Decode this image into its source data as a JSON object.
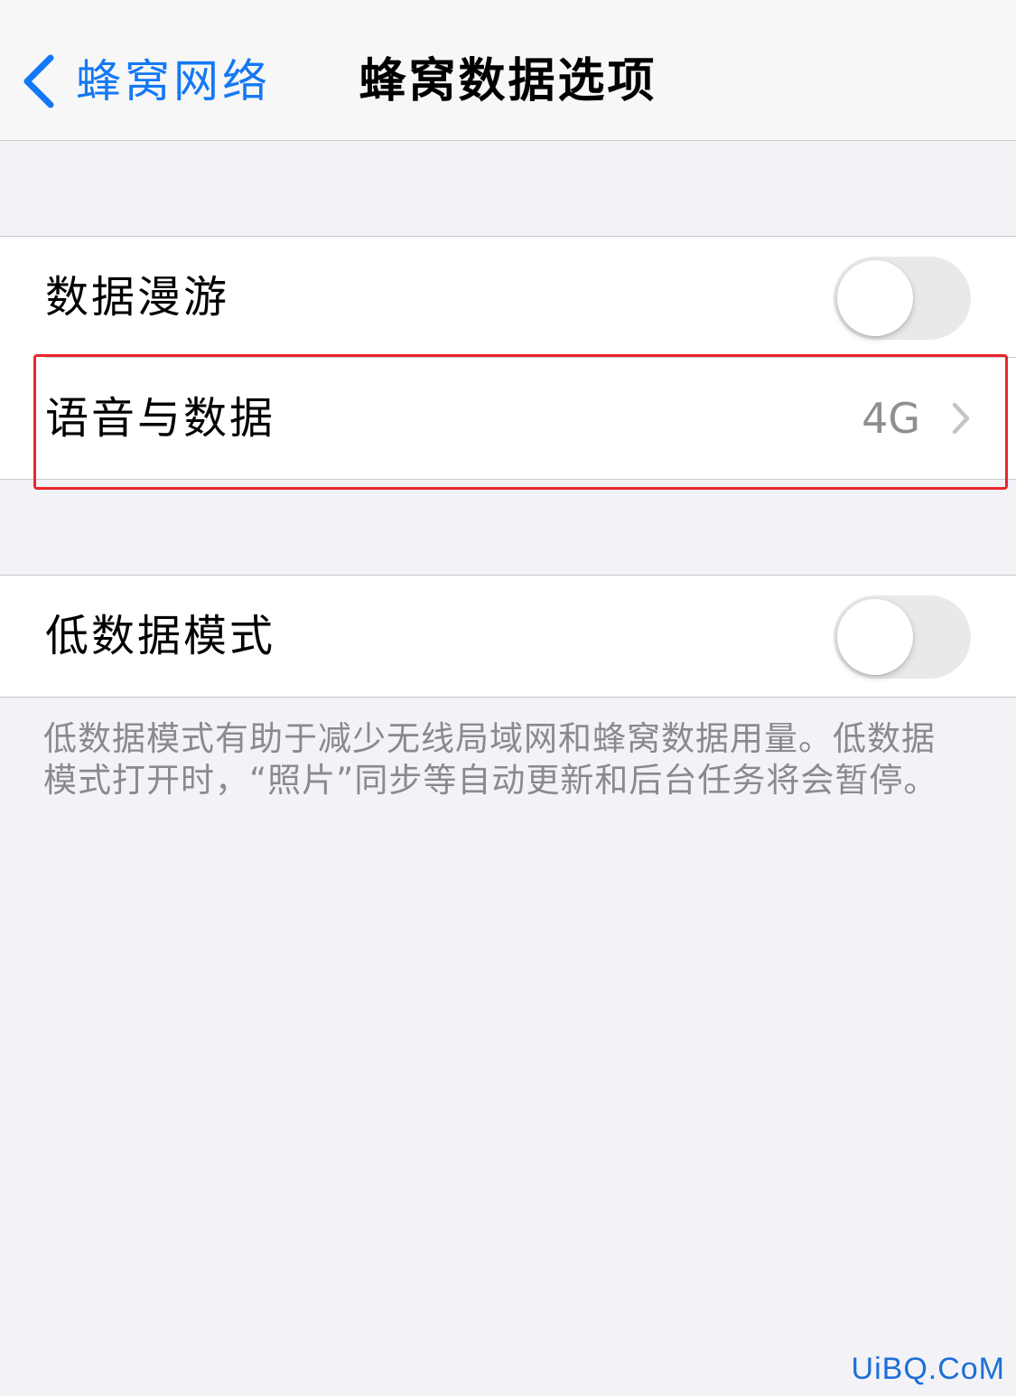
{
  "navbar": {
    "back_label": "蜂窝网络",
    "title": "蜂窝数据选项"
  },
  "group1": {
    "rows": [
      {
        "label": "数据漫游",
        "toggle_on": false
      },
      {
        "label": "语音与数据",
        "value": "4G"
      }
    ]
  },
  "group2": {
    "rows": [
      {
        "label": "低数据模式",
        "toggle_on": false
      }
    ],
    "footer": "低数据模式有助于减少无线局域网和蜂窝数据用量。低数据模式打开时，“照片”同步等自动更新和后台任务将会暂停。"
  },
  "watermark": "UiBQ.CoM",
  "colors": {
    "accent": "#1478f6",
    "highlight": "#e8262c",
    "toggle_off": "#e9e9eb",
    "secondary_text": "#8e8e93",
    "background": "#f2f2f7"
  },
  "icons": {
    "back": "chevron-left-icon",
    "disclosure": "chevron-right-icon"
  }
}
